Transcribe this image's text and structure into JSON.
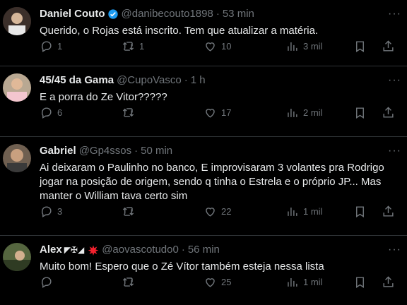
{
  "tweets": [
    {
      "name": "Daniel Couto",
      "handle": "@danibecouto1898",
      "time": "53 min",
      "text": "Querido, o Rojas está inscrito. Tem que atualizar a matéria.",
      "replies": "1",
      "reposts": "1",
      "likes": "10",
      "views": "3 mil",
      "verified": true,
      "avatar_color": "#3b2f2a"
    },
    {
      "name": "45/45 da Gama",
      "handle": "@CupoVasco",
      "time": "1 h",
      "text": "E a porra do Ze Vitor?????",
      "replies": "6",
      "reposts": "",
      "likes": "17",
      "views": "2 mil",
      "avatar_color": "#c9b8a6"
    },
    {
      "name": "Gabriel",
      "handle": "@Gp4ssos",
      "time": "50 min",
      "text": "Ai deixaram o Paulinho no banco, E improvisaram 3 volantes pra Rodrigo jogar na posição de origem, sendo q tinha o Estrela e o próprio JP... Mas manter o William tava certo sim",
      "replies": "3",
      "reposts": "",
      "likes": "22",
      "views": "1 mil",
      "avatar_color": "#7b6a58"
    },
    {
      "name": "Alex",
      "name_suffix": "◤✠◢",
      "handle": "@aovascotudo0",
      "time": "56 min",
      "text": "Muito bom! Espero que o Zé Vítor também esteja nessa lista",
      "replies": "",
      "reposts": "",
      "likes": "25",
      "views": "1 mil",
      "avatar_color": "#4a5a3a"
    }
  ],
  "ui": {
    "separator": "·",
    "more": "···",
    "accent": "#1d9bf0",
    "muted": "#71767b",
    "background": "#000000"
  }
}
